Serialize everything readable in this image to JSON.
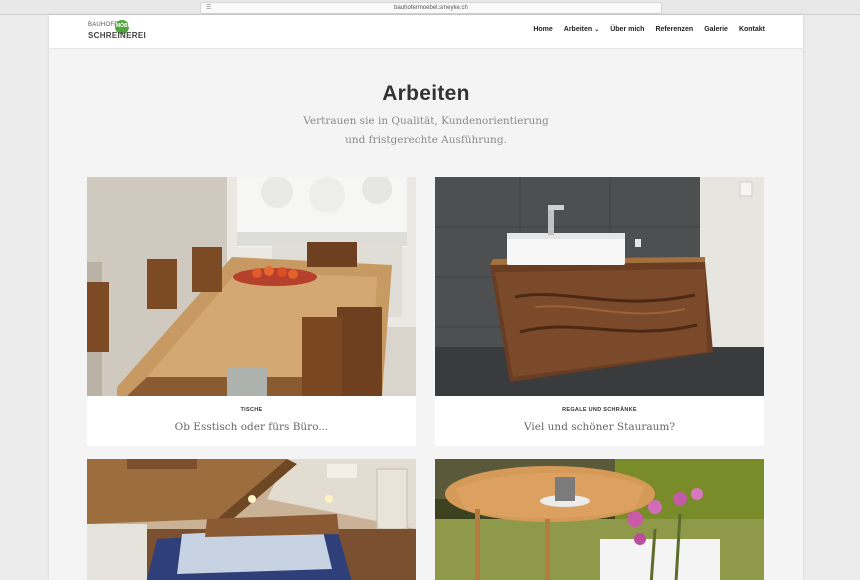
{
  "browser": {
    "url": "bauhofermoebel.smeyke.ch",
    "reader_glyph": "☰"
  },
  "logo": {
    "line1": "BAUHOFER",
    "line2": "SCHREINEREI",
    "badge": "MÖBEL"
  },
  "nav": {
    "items": [
      "Home",
      "Arbeiten",
      "Über mich",
      "Referenzen",
      "Galerie",
      "Kontakt"
    ],
    "chevron": "⌄"
  },
  "main": {
    "title": "Arbeiten",
    "subtitle": "Vertrauen sie in Qualität, Kundenorientierung und fristgerechte Ausführung."
  },
  "cards": [
    {
      "category": "TISCHE",
      "title": "Ob Esstisch oder fürs Büro..."
    },
    {
      "category": "REGALE UND SCHRÄNKE",
      "title": "Viel und schöner Stauraum?"
    },
    {
      "category": "",
      "title": ""
    },
    {
      "category": "",
      "title": ""
    }
  ]
}
